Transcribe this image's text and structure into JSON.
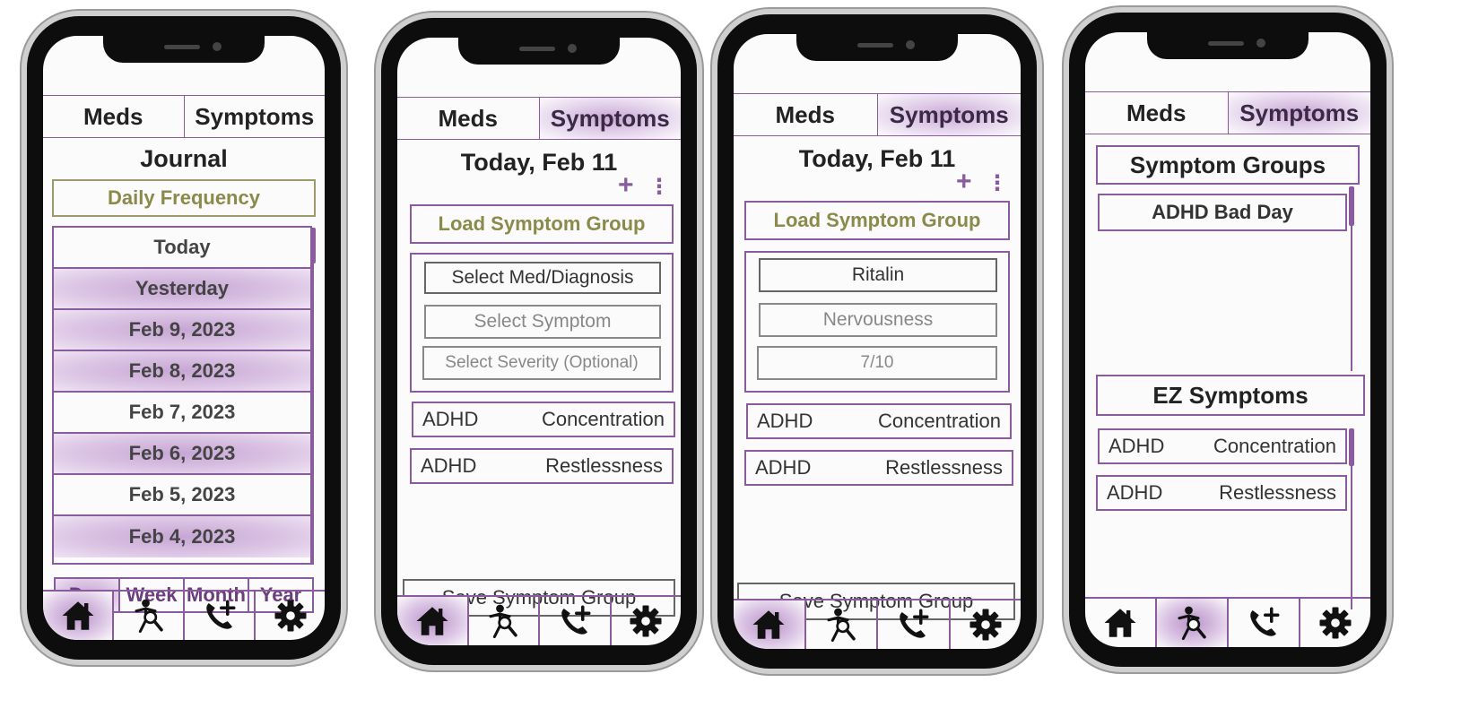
{
  "colors": {
    "accent": "#8a5c9e",
    "olive": "#8a8a4a",
    "phone": "#0d0d0d"
  },
  "tabs": {
    "meds": "Meds",
    "symptoms": "Symptoms"
  },
  "nav_icons": [
    "home-icon",
    "person-search-icon",
    "phone-add-icon",
    "gear-icon"
  ],
  "screen1": {
    "title": "Journal",
    "daily_frequency": "Daily Frequency",
    "dates": [
      {
        "label": "Today",
        "highlighted": false
      },
      {
        "label": "Yesterday",
        "highlighted": true
      },
      {
        "label": "Feb 9, 2023",
        "highlighted": true
      },
      {
        "label": "Feb 8, 2023",
        "highlighted": true
      },
      {
        "label": "Feb 7, 2023",
        "highlighted": false
      },
      {
        "label": "Feb 6, 2023",
        "highlighted": true
      },
      {
        "label": "Feb 5, 2023",
        "highlighted": false
      },
      {
        "label": "Feb 4, 2023",
        "highlighted": true
      }
    ],
    "periods": [
      "Day",
      "Week",
      "Month",
      "Year"
    ],
    "active_period": "Day",
    "active_nav": "home-icon"
  },
  "screen2": {
    "title": "Today, Feb 11",
    "plus": "+",
    "menu": "⋮",
    "load_group": "Load Symptom Group",
    "med_diag": "Select Med/Diagnosis",
    "symptom": "Select Symptom",
    "severity": "Select Severity (Optional)",
    "rows": [
      {
        "left": "ADHD",
        "right": "Concentration"
      },
      {
        "left": "ADHD",
        "right": "Restlessness"
      }
    ],
    "save": "Save Symptom Group",
    "active_nav": "home-icon"
  },
  "screen3": {
    "title": "Today, Feb 11",
    "plus": "+",
    "menu": "⋮",
    "load_group": "Load Symptom Group",
    "med_diag": "Ritalin",
    "symptom": "Nervousness",
    "severity": "7/10",
    "rows": [
      {
        "left": "ADHD",
        "right": "Concentration"
      },
      {
        "left": "ADHD",
        "right": "Restlessness"
      }
    ],
    "save": "Save Symptom Group",
    "active_nav": "home-icon"
  },
  "screen4": {
    "groups_title": "Symptom Groups",
    "groups": [
      "ADHD Bad Day"
    ],
    "ez_title": "EZ Symptoms",
    "rows": [
      {
        "left": "ADHD",
        "right": "Concentration"
      },
      {
        "left": "ADHD",
        "right": "Restlessness"
      }
    ],
    "active_nav": "person-search-icon"
  }
}
